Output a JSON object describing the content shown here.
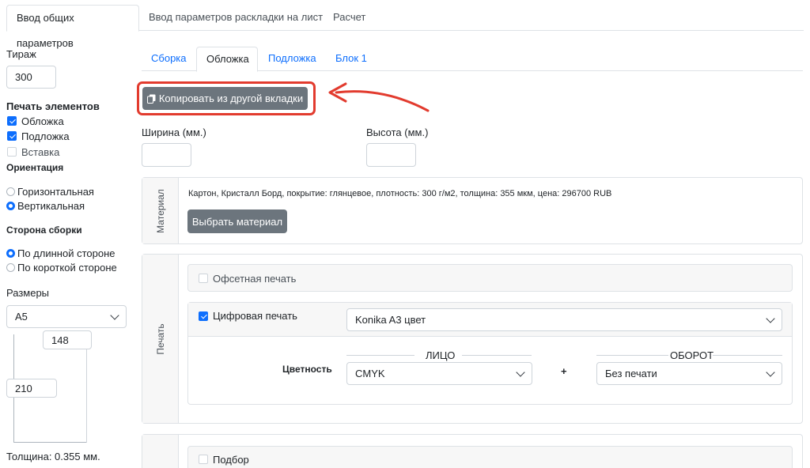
{
  "top_tabs": [
    "Ввод общих параметров",
    "Ввод параметров раскладки на лист",
    "Расчет"
  ],
  "sidebar": {
    "circulation_label": "Тираж",
    "circulation_value": "300",
    "print_elements_label": "Печать элементов",
    "elements": [
      {
        "label": "Обложка",
        "checked": true
      },
      {
        "label": "Подложка",
        "checked": true
      },
      {
        "label": "Вставка",
        "checked": false
      }
    ],
    "orientation_label": "Ориентация",
    "orientations": [
      {
        "label": "Горизонтальная",
        "selected": false
      },
      {
        "label": "Вертикальная",
        "selected": true
      }
    ],
    "binding_side_label": "Сторона сборки",
    "binding_sides": [
      {
        "label": "По длинной стороне",
        "selected": true
      },
      {
        "label": "По короткой стороне",
        "selected": false
      }
    ],
    "sizes_label": "Размеры",
    "size_value": "A5",
    "width_value": "148",
    "height_value": "210",
    "thickness": "Толщина: 0.355 мм."
  },
  "sub_tabs": [
    "Сборка",
    "Обложка",
    "Подложка",
    "Блок 1"
  ],
  "copy_button": "Копировать из другой вкладки",
  "width_label": "Ширина (мм.)",
  "height_label": "Высота (мм.)",
  "material": {
    "side_label": "Материал",
    "description": "Картон, Кристалл Борд, покрытие: глянцевое, плотность: 300 г/м2, толщина: 355 мкм, цена: 296700 RUB",
    "select_button": "Выбрать материал"
  },
  "print": {
    "side_label": "Печать",
    "offset_label": "Офсетная печать",
    "digital_label": "Цифровая печать",
    "printer_value": "Konika A3 цвет",
    "face_label": "ЛИЦО",
    "back_label": "ОБОРОТ",
    "color_label": "Цветность",
    "face_value": "CMYK",
    "plus": "+",
    "back_value": "Без печати"
  },
  "selection_label": "Подбор",
  "colors": {
    "accent": "#0d6efd",
    "highlight": "#e23b2e",
    "button": "#6c757d"
  }
}
